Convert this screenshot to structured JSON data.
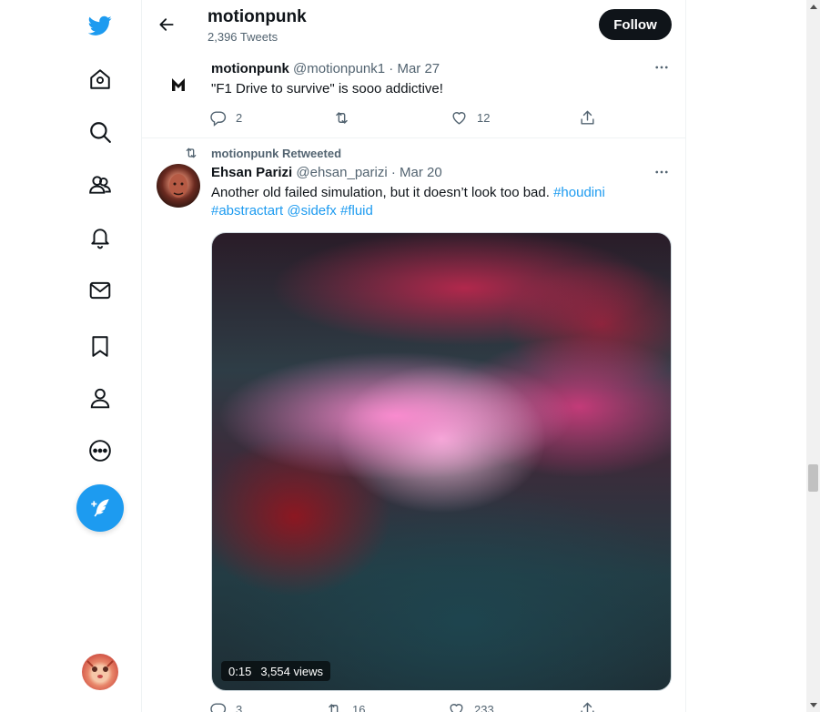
{
  "header": {
    "name": "motionpunk",
    "tweet_count": "2,396 Tweets",
    "follow_label": "Follow"
  },
  "tweets": [
    {
      "name": "motionpunk",
      "handle": "@motionpunk1",
      "date": "Mar 27",
      "text": "\"F1 Drive to survive\" is sooo addictive!",
      "replies": "2",
      "retweets": "",
      "likes": "12"
    },
    {
      "retweeted_by": "motionpunk Retweeted",
      "name": "Ehsan Parizi",
      "handle": "@ehsan_parizi",
      "date": "Mar 20",
      "text": "Another old failed simulation, but it doesn’t look too bad.",
      "tags": [
        "#houdini",
        "#abstractart",
        "@sidefx",
        "#fluid"
      ],
      "media_duration": "0:15",
      "media_views": "3,554 views",
      "replies": "3",
      "retweets": "16",
      "likes": "233"
    }
  ],
  "colors": {
    "accent": "#1d9bf0",
    "text": "#0f1419",
    "muted": "#536471"
  }
}
